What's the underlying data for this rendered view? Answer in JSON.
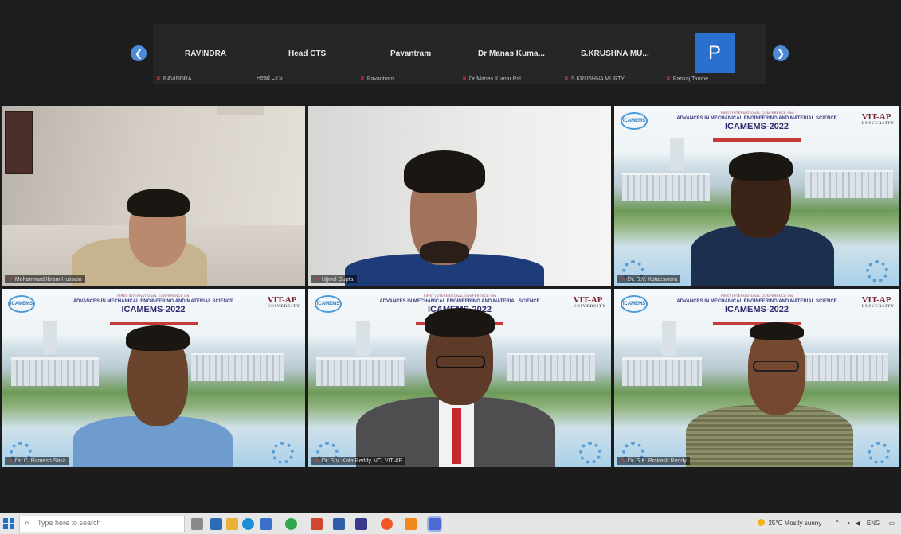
{
  "strip": {
    "thumbnails": [
      {
        "name": "RAVINDRA",
        "sub": "RAVINDRA",
        "sub_muted": true
      },
      {
        "name": "Head CTS",
        "sub": "Head CTS",
        "sub_muted": false
      },
      {
        "name": "Pavantram",
        "sub": "Pavantram",
        "sub_muted": true
      },
      {
        "name": "Dr Manas Kuma...",
        "sub": "Dr Manas Kumar Pal",
        "sub_muted": true
      },
      {
        "name": "S.KRUSHNA MU...",
        "sub": "S.KRUSHNA MURTY",
        "sub_muted": true
      },
      {
        "name": "P",
        "sub": "Pankaj Tambe",
        "sub_muted": true
      }
    ],
    "prev_icon": "chevron-left-icon",
    "next_icon": "chevron-right-icon"
  },
  "conference": {
    "small": "FIRST INTERNATIONAL CONFERENCE ON",
    "title": "ADVANCES IN MECHANICAL ENGINEERING AND MATERIAL SCIENCE",
    "short": "ICAMEMS-2022",
    "org": "VIT-AP",
    "org_sub": "UNIVERSITY",
    "logo": "ICAMEMS"
  },
  "tiles": [
    {
      "label": "Mohammad Ikram Hussain",
      "active": false
    },
    {
      "label": "Ujjwal Gupta",
      "active": false
    },
    {
      "label": "Dr. S.V. Kotaeswara",
      "active": false
    },
    {
      "label": "Dr. C. Ramesh Sasa",
      "active": true
    },
    {
      "label": "Dr. S.V. Kota Reddy, VC, VIT-AP",
      "active": false
    },
    {
      "label": "Dr. S.K. Prakash Reddy",
      "active": false
    }
  ],
  "taskbar": {
    "search_placeholder": "Type here to search",
    "weather": "25°C  Mostly sunny",
    "tray_text": "ENG",
    "colors": {
      "accent": "#1e6fc8",
      "muted": "#e0383b",
      "active_border": "#d7d44a"
    }
  }
}
